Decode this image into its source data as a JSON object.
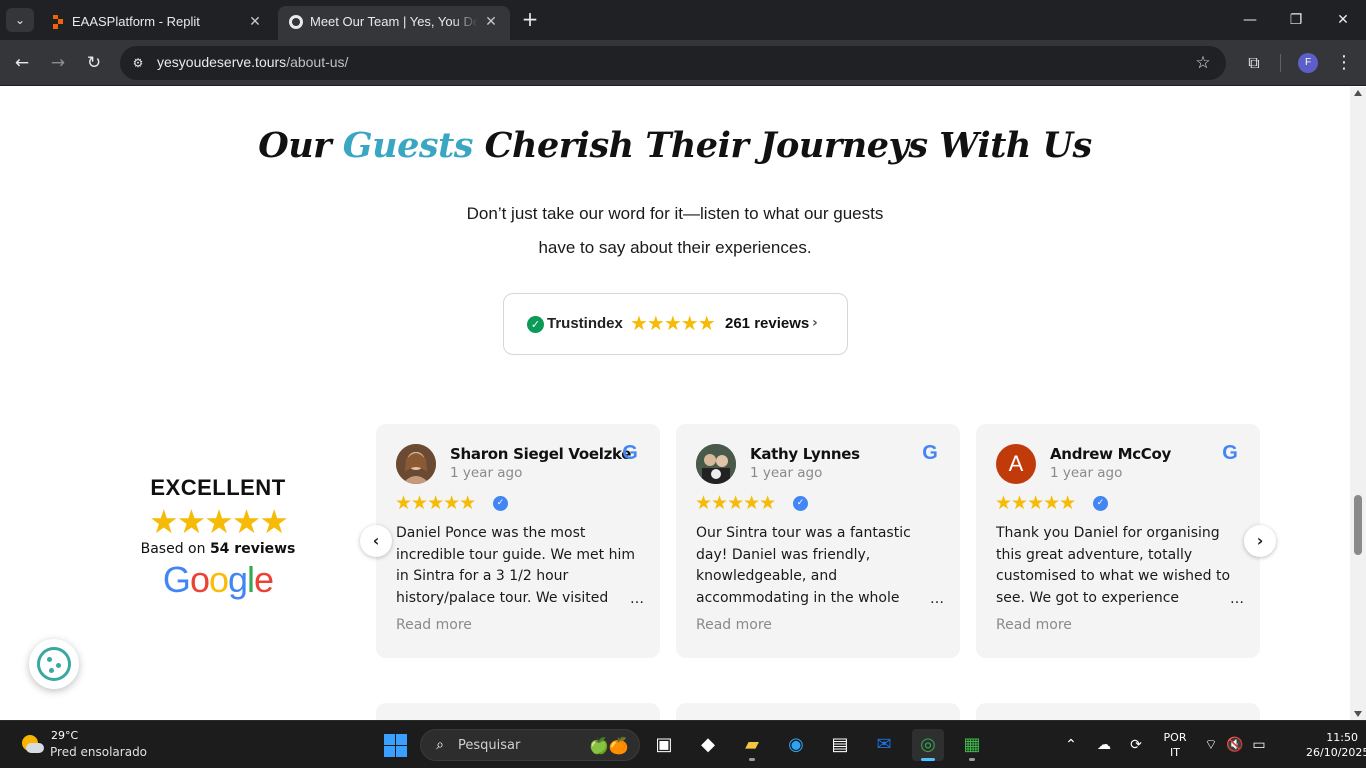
{
  "browser": {
    "tabs": [
      {
        "title": "EAASPlatform - Replit",
        "active": false
      },
      {
        "title": "Meet Our Team | Yes, You Deserve",
        "active": true
      }
    ],
    "address": {
      "domain": "yesyoudeserve.tours",
      "path": "/about-us/"
    },
    "profile_initial": "F"
  },
  "page": {
    "heading": {
      "before": "Our ",
      "accent": "Guests",
      "after": " Cherish Their Journeys With Us"
    },
    "subtitle": "Don’t just take our word for it—listen to what our guests have to say about their experiences.",
    "trustindex": {
      "brand": "Trustindex",
      "stars": "★★★★★",
      "reviews": "261 reviews"
    },
    "summary": {
      "rating_word": "EXCELLENT",
      "stars": "★★★★★",
      "based_prefix": "Based on ",
      "based_count": "54 reviews",
      "logo_letters": [
        "G",
        "o",
        "o",
        "g",
        "l",
        "e"
      ]
    },
    "reviews": [
      {
        "name": "Sharon Siegel Voelzke",
        "ago": "1 year ago",
        "stars": "★★★★★",
        "text": "Daniel Ponce was the most incredible tour guide. We met him in Sintra for a 3 1/2 hour history/palace tour. We visited",
        "read_more": "Read more"
      },
      {
        "name": "Kathy Lynnes",
        "ago": "1 year ago",
        "stars": "★★★★★",
        "text": "Our Sintra tour was a fantastic day! Daniel was friendly, knowledgeable, and accommodating in the whole",
        "read_more": "Read more"
      },
      {
        "name": "Andrew McCoy",
        "ago": "1 year ago",
        "stars": "★★★★★",
        "text": "Thank you Daniel for organising this great adventure, totally customised to what we wished to see. We got to experience",
        "read_more": "Read more",
        "avatar_letter": "A"
      }
    ],
    "colors": {
      "accent": "#3aa7c2",
      "star": "#f6bb06",
      "card_bg": "#f4f4f4",
      "trust_green": "#0b9a58"
    }
  },
  "taskbar": {
    "weather_temp": "29°C",
    "weather_desc": "Pred ensolarado",
    "search_placeholder": "Pesquisar",
    "lang_line1": "POR",
    "lang_line2": "IT",
    "time": "11:50",
    "date": "26/10/2025"
  }
}
